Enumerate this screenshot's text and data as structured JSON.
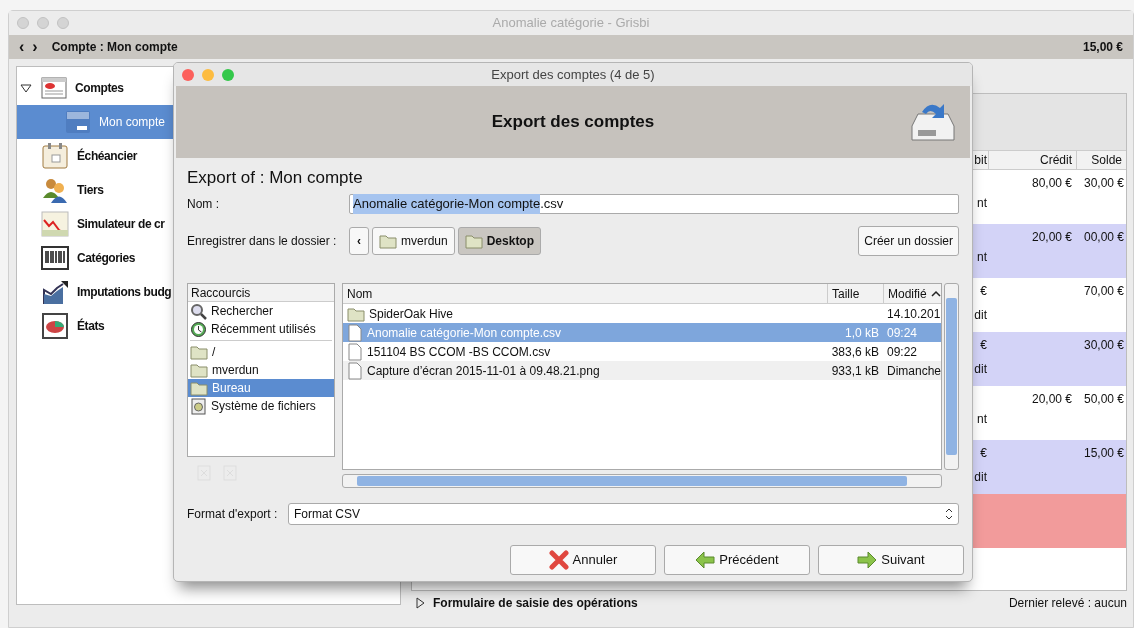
{
  "window": {
    "title": "Anomalie catégorie - Grisbi"
  },
  "toolbar": {
    "back": "‹",
    "forward": "›",
    "title": "Compte : Mon compte",
    "balance": "15,00 €"
  },
  "sidebar": {
    "items": [
      {
        "label": "Comptes",
        "kind": "accounts",
        "expanded": true,
        "selected": false,
        "children": [
          {
            "label": "Mon compte",
            "kind": "card",
            "selected": true
          }
        ]
      },
      {
        "label": "Échéancier",
        "kind": "calendar",
        "selected": false
      },
      {
        "label": "Tiers",
        "kind": "people",
        "selected": false
      },
      {
        "label": "Simulateur de cr",
        "kind": "chart",
        "selected": false
      },
      {
        "label": "Catégories",
        "kind": "barcode",
        "selected": false
      },
      {
        "label": "Imputations budg",
        "kind": "budget",
        "selected": false
      },
      {
        "label": "États",
        "kind": "report",
        "selected": false
      }
    ]
  },
  "transactions": {
    "columns": [
      "bit",
      "Crédit",
      "Solde"
    ],
    "rows": [
      {
        "debit": "",
        "debit_line2": "nt",
        "credit": "80,00 €",
        "balance": "30,00 €",
        "color": "#ffffff"
      },
      {
        "debit": "",
        "debit_line2": "nt",
        "credit": "20,00 €",
        "balance": "00,00 €",
        "color": "#d3d3f7"
      },
      {
        "debit": "€",
        "debit_line2": "dit",
        "credit": "",
        "balance": "70,00 €",
        "color": "#ffffff"
      },
      {
        "debit": "€",
        "debit_line2": "dit",
        "credit": "",
        "balance": "30,00 €",
        "color": "#d3d3f7"
      },
      {
        "debit": "",
        "debit_line2": "nt",
        "credit": "20,00 €",
        "balance": "50,00 €",
        "color": "#ffffff"
      },
      {
        "debit": "€",
        "debit_line2": "dit",
        "credit": "",
        "balance": "15,00 €",
        "color": "#d3d3f7"
      },
      {
        "debit": "",
        "debit_line2": "",
        "credit": "",
        "balance": "",
        "color": "#f29b9b"
      }
    ]
  },
  "form_expander": {
    "label": "Formulaire de saisie des opérations",
    "expanded": false
  },
  "last_statement": "Dernier relevé : aucun",
  "dialog": {
    "title": "Export des comptes (4 de 5)",
    "header": "Export des comptes",
    "heading": "Export of : Mon compte",
    "name_label": "Nom :",
    "name_value": [
      {
        "text": "Anomalie catégorie-Mon compte",
        "selected": true
      },
      {
        "text": ".csv",
        "selected": false
      }
    ],
    "folder_label": "Enregistrer dans le dossier :",
    "path_back": "‹",
    "path": [
      {
        "label": "mverdun",
        "selected": false
      },
      {
        "label": "Desktop",
        "selected": true
      }
    ],
    "create_folder": "Créer un dossier",
    "shortcuts": {
      "header": "Raccourcis",
      "groups": [
        [
          {
            "label": "Rechercher",
            "kind": "search",
            "selected": false
          },
          {
            "label": "Récemment utilisés",
            "kind": "recent",
            "selected": false
          }
        ],
        [
          {
            "label": "/",
            "kind": "folder",
            "selected": false
          },
          {
            "label": "mverdun",
            "kind": "folder",
            "selected": false
          },
          {
            "label": "Bureau",
            "kind": "folder",
            "selected": true
          },
          {
            "label": "Système de fichiers",
            "kind": "drive",
            "selected": false
          }
        ]
      ]
    },
    "files": {
      "columns": [
        "Nom",
        "Taille",
        "Modifié"
      ],
      "rows": [
        {
          "name": "SpiderOak Hive",
          "kind": "folder",
          "size": "",
          "modified": "14.10.201",
          "selected": false
        },
        {
          "name": "Anomalie catégorie-Mon compte.csv",
          "kind": "file",
          "size": "1,0 kB",
          "modified": "09:24",
          "selected": true
        },
        {
          "name": "151104 BS CCOM -BS CCOM.csv",
          "kind": "file",
          "size": "383,6 kB",
          "modified": "09:22",
          "selected": false
        },
        {
          "name": "Capture d’écran 2015-11-01 à 09.48.21.png",
          "kind": "file",
          "size": "933,1 kB",
          "modified": "Dimanche",
          "selected": false
        }
      ]
    },
    "format_label": "Format d'export :",
    "format_value": "Format CSV",
    "buttons": [
      {
        "label": "Annuler",
        "kind": "cancel"
      },
      {
        "label": "Précédent",
        "kind": "back"
      },
      {
        "label": "Suivant",
        "kind": "next"
      }
    ]
  }
}
